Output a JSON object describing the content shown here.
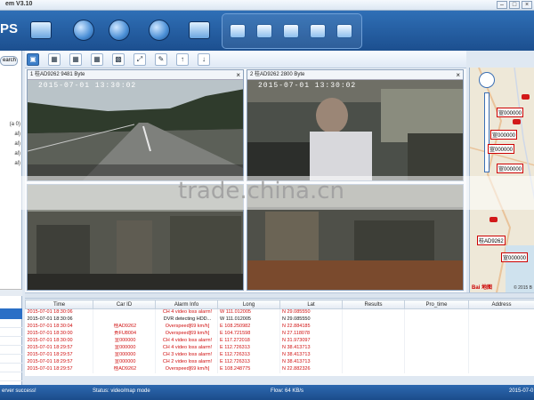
{
  "app": {
    "title": "em V3.10",
    "logo_text": "PS"
  },
  "toolbar": {
    "icons": [
      "grid-view-icon",
      "camera-icon",
      "speed-dial-icon",
      "gauge-icon",
      "map-icon"
    ],
    "group_icons": [
      "home-icon",
      "car-icon",
      "monitor-icon",
      "settings-icon",
      "book-icon"
    ]
  },
  "left_panel": {
    "search_label": "earch",
    "tree_items": [
      "(a 0)",
      "al)",
      "al)",
      "al)",
      "al)"
    ]
  },
  "video_toolbar": {
    "buttons": [
      "layout-1-icon",
      "layout-4-icon",
      "layout-6-icon",
      "layout-8-icon",
      "layout-9-icon",
      "fullscreen-icon",
      "capture-icon",
      "up-icon",
      "down-icon"
    ]
  },
  "video_cells": [
    {
      "header": "1 桂AD9262  9481 Byte",
      "timestamp": "2015-07-01  13:30:02"
    },
    {
      "header": "2 桂AD9262  2800 Byte",
      "timestamp": "2015-07-01  13:30:02"
    }
  ],
  "map": {
    "tags": [
      "宣000000",
      "宣000000",
      "宣000000",
      "宣000000",
      "桂AD9262",
      "宣000000"
    ],
    "copyright": "Bai 地图",
    "copyright2": "© 2015 B"
  },
  "alarm_table": {
    "columns": [
      "Time",
      "Car ID",
      "Alarm Info",
      "Long",
      "Lat",
      "Results",
      "Pro_time",
      "Address"
    ],
    "rows": [
      {
        "time": "2015-07-01 18:30:06",
        "car_id": "",
        "alarm": "CH 4 video loss alarm!",
        "long": "W 111.012005",
        "lat": "N 29.085550",
        "color": "#d01010"
      },
      {
        "time": "2015-07-01 18:30:06",
        "car_id": "",
        "alarm": "DVR detecting HDD...",
        "long": "W 111.012005",
        "lat": "N 29.085550",
        "color": "#111111"
      },
      {
        "time": "2015-07-01 18:30:04",
        "car_id": "桂AD9262",
        "alarm": "Overspeed[69 km/h]",
        "long": "E 108.250982",
        "lat": "N 22.884185",
        "color": "#d01010"
      },
      {
        "time": "2015-07-01 18:30:00",
        "car_id": "贵FU8004",
        "alarm": "Overspeed[69 km/h]",
        "long": "E 104.721598",
        "lat": "N 27.118078",
        "color": "#d01010"
      },
      {
        "time": "2015-07-01 18:30:00",
        "car_id": "宣000000",
        "alarm": "CH 4 video loss alarm!",
        "long": "E 117.272018",
        "lat": "N 31.973097",
        "color": "#d01010"
      },
      {
        "time": "2015-07-01 18:29:57",
        "car_id": "宣000000",
        "alarm": "CH 4 video loss alarm!",
        "long": "E 112.726313",
        "lat": "N 38.413713",
        "color": "#d01010"
      },
      {
        "time": "2015-07-01 18:29:57",
        "car_id": "宣000000",
        "alarm": "CH 3 video loss alarm!",
        "long": "E 112.726313",
        "lat": "N 38.413713",
        "color": "#d01010"
      },
      {
        "time": "2015-07-01 18:29:57",
        "car_id": "宣000000",
        "alarm": "CH 2 video loss alarm!",
        "long": "E 112.726313",
        "lat": "N 38.413713",
        "color": "#d01010"
      },
      {
        "time": "2015-07-01 18:29:57",
        "car_id": "桂AD9262",
        "alarm": "Overspeed[69 km/h]",
        "long": "E 108.248775",
        "lat": "N 22.882326",
        "color": "#d01010"
      }
    ]
  },
  "status": {
    "left": "erver success!",
    "mode": "Status: video/map mode",
    "flow": "Flow: 64 KB/s",
    "date": "2015-07-0"
  },
  "watermark": "trade.china.cn"
}
